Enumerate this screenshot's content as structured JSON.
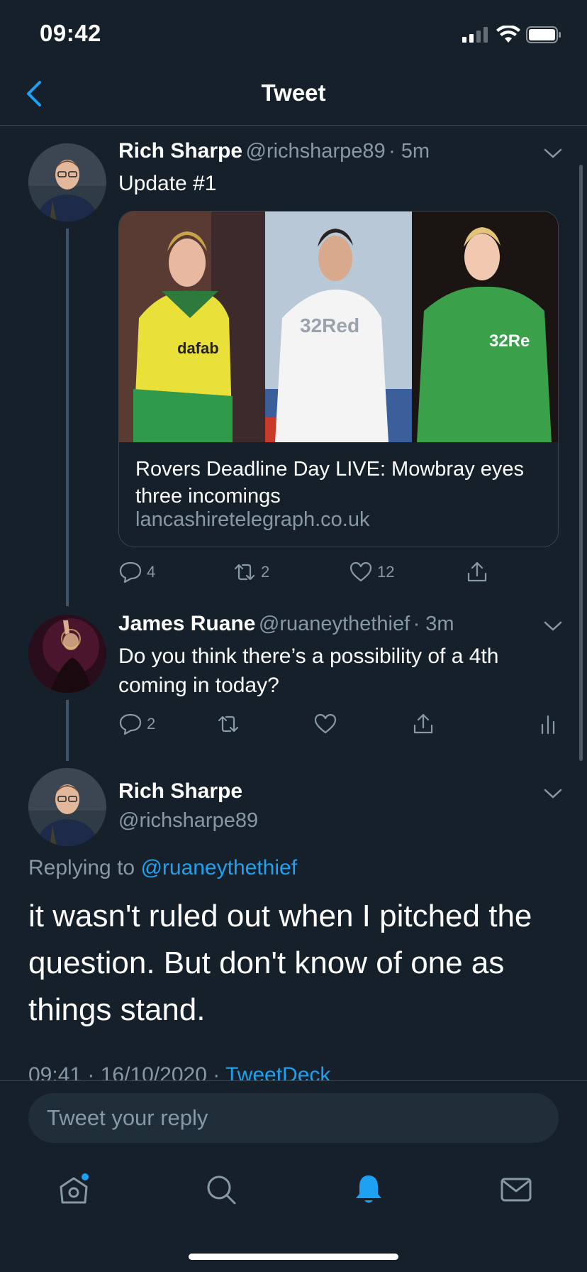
{
  "status_bar": {
    "time": "09:42"
  },
  "nav": {
    "title": "Tweet"
  },
  "tweets": [
    {
      "name": "Rich Sharpe",
      "handle": "@richsharpe89",
      "time": "· 5m",
      "text": "Update #1",
      "card": {
        "title": "Rovers Deadline Day LIVE: Mowbray eyes three incomings",
        "domain": "lancashiretelegraph.co.uk"
      },
      "actions": {
        "replies": "4",
        "retweets": "2",
        "likes": "12"
      }
    },
    {
      "name": "James Ruane",
      "handle": "@ruaneythethief",
      "time": "· 3m",
      "text": "Do you think there’s a possibility of a 4th coming in today?",
      "actions": {
        "replies": "2"
      }
    }
  ],
  "main_tweet": {
    "name": "Rich Sharpe",
    "handle": "@richsharpe89",
    "replying_prefix": "Replying to",
    "replying_mention": "@ruaneythethief",
    "text": "it wasn't ruled out when I pitched the question. But don't know of one as things stand.",
    "timestamp": "09:41 · 16/10/2020 · ",
    "source": "TweetDeck"
  },
  "composer": {
    "placeholder": "Tweet your reply"
  },
  "colors": {
    "background": "#15202b",
    "accent": "#1da1f2",
    "muted": "#8899a6",
    "divider": "#38444d"
  },
  "icons": [
    "back-chevron-icon",
    "reply-icon",
    "retweet-icon",
    "like-icon",
    "share-icon",
    "analytics-icon",
    "home-icon",
    "search-icon",
    "notifications-bell-icon",
    "messages-icon"
  ]
}
